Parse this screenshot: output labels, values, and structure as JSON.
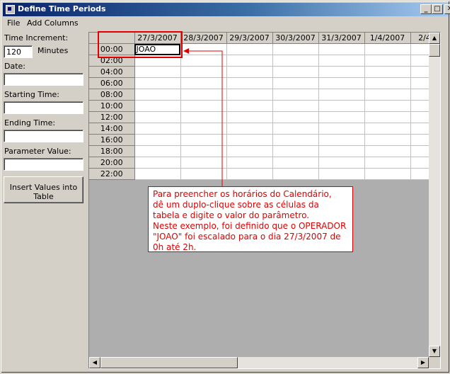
{
  "window": {
    "title": "Define Time Periods"
  },
  "title_buttons": {
    "minimize": "_",
    "maximize": "□",
    "close": "✕"
  },
  "menu": [
    "File",
    "Add Columns"
  ],
  "form": {
    "time_increment_label": "Time Increment:",
    "time_increment_value": "120",
    "minutes_label": "Minutes",
    "date_label": "Date:",
    "date_value": "",
    "starting_time_label": "Starting Time:",
    "starting_time_value": "",
    "ending_time_label": "Ending Time:",
    "ending_time_value": "",
    "parameter_value_label": "Parameter Value:",
    "parameter_value_value": "",
    "insert_button_line1": "Insert Values into",
    "insert_button_line2": "Table"
  },
  "grid": {
    "columns": [
      "27/3/2007",
      "28/3/2007",
      "29/3/2007",
      "30/3/2007",
      "31/3/2007",
      "1/4/2007",
      "2/4"
    ],
    "rows": [
      "00:00",
      "02:00",
      "04:00",
      "06:00",
      "08:00",
      "10:00",
      "12:00",
      "14:00",
      "16:00",
      "18:00",
      "20:00",
      "22:00"
    ],
    "edit_cell_value": "JOAO"
  },
  "callout": {
    "lines": [
      "Para preencher os horários do Calendário,",
      "dê um duplo-clique sobre as células da",
      "tabela e digite o valor do parâmetro.",
      "Neste exemplo, foi definido que o OPERADOR",
      "\"JOAO\" foi escalado para o dia 27/3/2007 de",
      "0h até 2h."
    ]
  },
  "colors": {
    "annotation": "#e00000",
    "title_gradient_start": "#0a246a",
    "title_gradient_end": "#a6caf0"
  }
}
